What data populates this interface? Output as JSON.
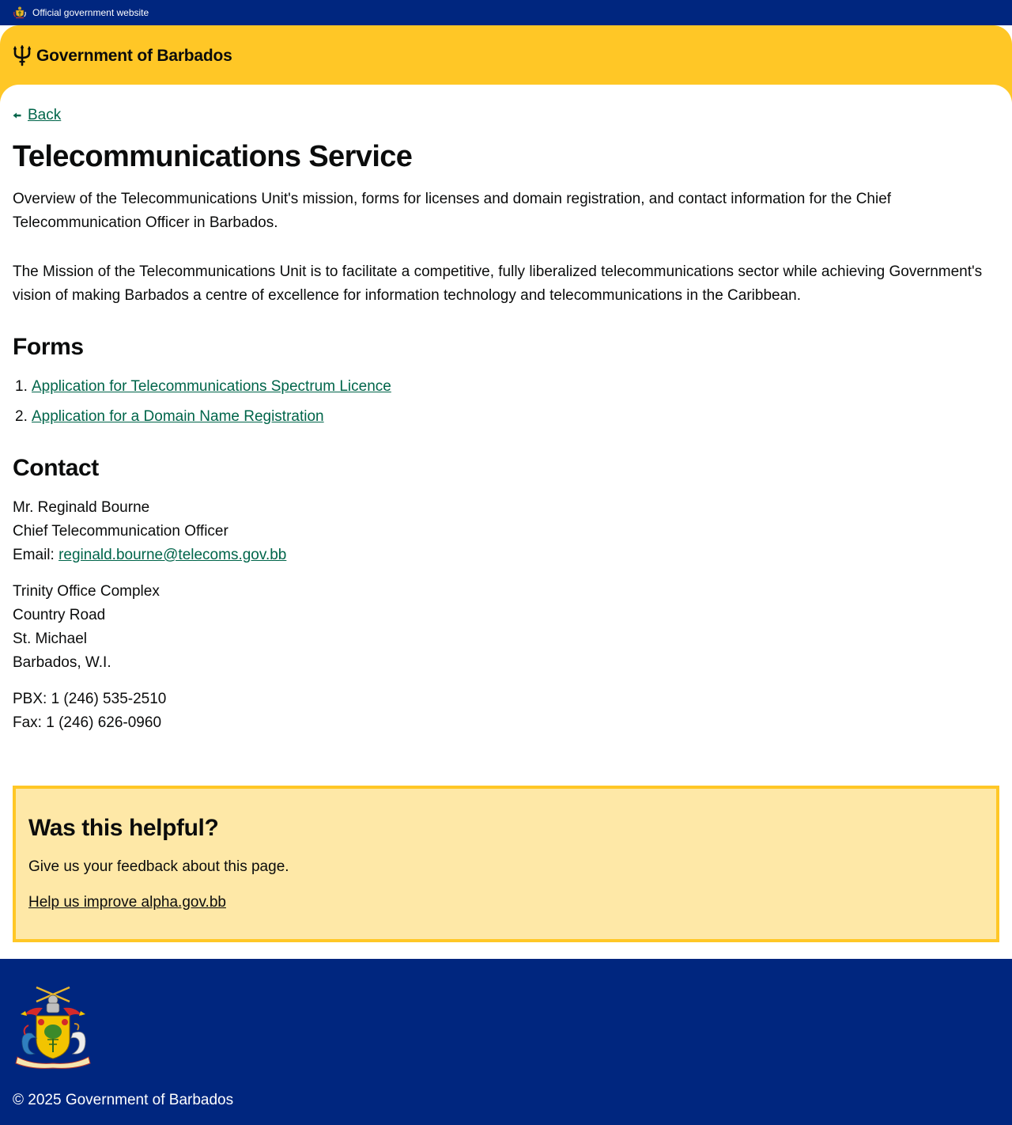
{
  "topbar": {
    "official_label": "Official government website"
  },
  "header": {
    "brand_name": "Government of Barbados"
  },
  "nav": {
    "back_label": "Back"
  },
  "main": {
    "title": "Telecommunications Service",
    "summary": "Overview of the Telecommunications Unit's mission, forms for licenses and domain registration, and contact information for the Chief Telecommunication Officer in Barbados.",
    "mission": "The Mission of the Telecommunications Unit is to facilitate a competitive, fully liberalized telecommunications sector while achieving Government's vision of making Barbados a centre of excellence for information technology and telecommunications in the Caribbean.",
    "forms_heading": "Forms",
    "forms": [
      {
        "num": "1.",
        "label": "Application for Telecommunications Spectrum Licence"
      },
      {
        "num": "2.",
        "label": "Application for a Domain Name Registration"
      }
    ],
    "contact_heading": "Contact",
    "contact": {
      "name": "Mr. Reginald Bourne",
      "role": "Chief Telecommunication Officer",
      "email_label": "Email:",
      "email": "reginald.bourne@telecoms.gov.bb",
      "address": [
        "Trinity Office Complex",
        "Country Road",
        "St. Michael",
        "Barbados, W.I."
      ],
      "pbx": "PBX: 1 (246) 535-2510",
      "fax": "Fax: 1 (246) 626-0960"
    }
  },
  "feedback": {
    "title": "Was this helpful?",
    "text": "Give us your feedback about this page.",
    "link_label": "Help us improve alpha.gov.bb"
  },
  "footer": {
    "copyright": "© 2025 Government of Barbados"
  },
  "colors": {
    "navy": "#00267f",
    "gold": "#ffc726",
    "feedback_bg": "#fee8a7",
    "link": "#00654a",
    "text": "#0b0c0c"
  },
  "icons": {
    "topbar": "coat-of-arms-icon",
    "brand": "trident-icon",
    "back": "arrow-left-icon",
    "footer": "coat-of-arms-icon"
  }
}
